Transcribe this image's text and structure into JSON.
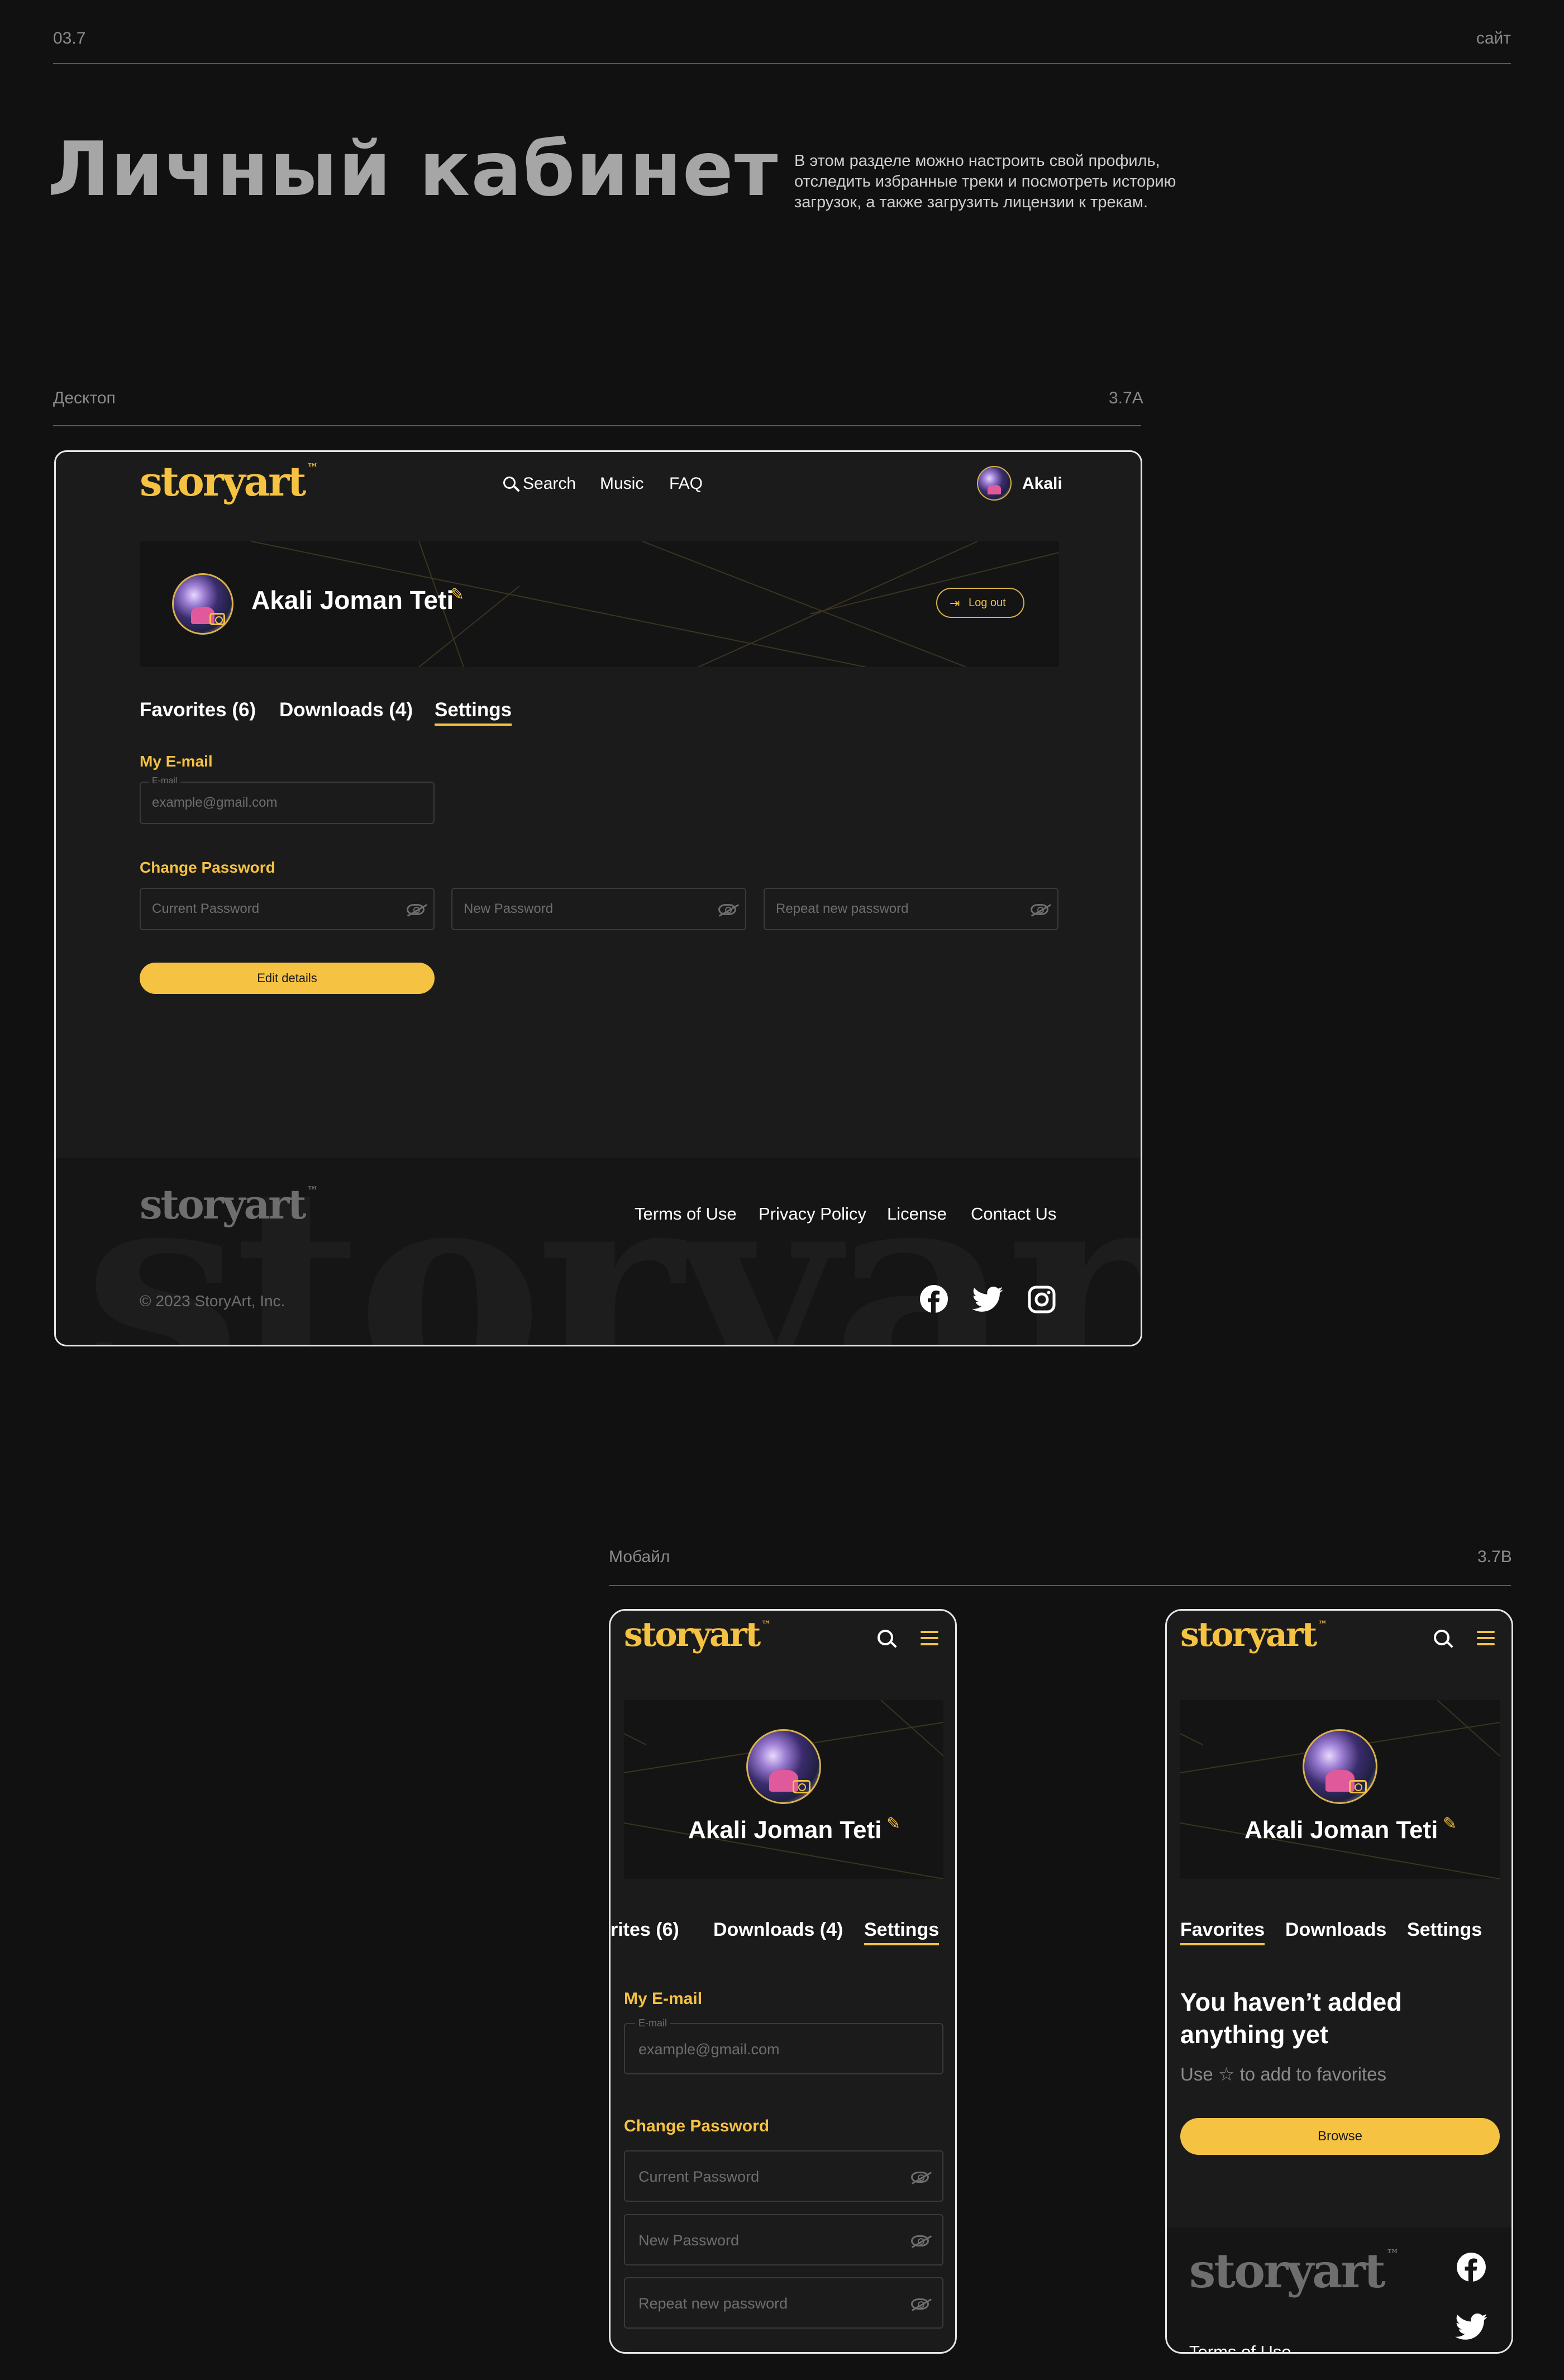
{
  "page": {
    "section_number": "03.7",
    "section_tag": "сайт",
    "title": "Личный кабинет",
    "description": "В этом разделе можно настроить свой профиль, отследить избранные треки и посмотреть историю загрузок, а также загрузить лицензии к трекам."
  },
  "desktop": {
    "label": "Десктоп",
    "code": "3.7A",
    "logo": "storyart",
    "tm": "™",
    "nav": {
      "search": "Search",
      "music": "Music",
      "faq": "FAQ"
    },
    "user_name": "Akali",
    "profile_name": "Akali Joman Teti",
    "logout": "Log out",
    "tabs": [
      "Favorites (6)",
      "Downloads (4)",
      "Settings"
    ],
    "email_section": "My E-mail",
    "email_label": "E-mail",
    "email_placeholder": "example@gmail.com",
    "password_section": "Change Password",
    "current_password": "Current Password",
    "new_password": "New Password",
    "repeat_password": "Repeat new password",
    "edit_button": "Edit details",
    "footer_links": [
      "Terms of Use",
      "Privacy Policy",
      "License",
      "Contact Us"
    ],
    "copyright": "© 2023 StoryArt, Inc.",
    "footer_bg_word": "storyart"
  },
  "mobile": {
    "label": "Мобайл",
    "code": "3.7B",
    "logo": "storyart",
    "tm": "™",
    "profile_name": "Akali Joman Teti",
    "left": {
      "tabs": [
        "rites (6)",
        "Downloads (4)",
        "Settings"
      ],
      "email_section": "My E-mail",
      "email_label": "E-mail",
      "email_placeholder": "example@gmail.com",
      "password_section": "Change Password",
      "current_password": "Current Password",
      "new_password": "New Password",
      "repeat_password": "Repeat new password"
    },
    "right": {
      "tabs": [
        "Favorites",
        "Downloads",
        "Settings"
      ],
      "empty_title": "You haven’t added anything yet",
      "empty_hint_pre": "Use",
      "empty_hint_icon": "☆",
      "empty_hint_post": "to add to favorites",
      "browse": "Browse",
      "footer_link": "Terms of Use"
    }
  },
  "colors": {
    "accent": "#f5c242",
    "background": "#111111",
    "panel": "#1b1b1b"
  }
}
